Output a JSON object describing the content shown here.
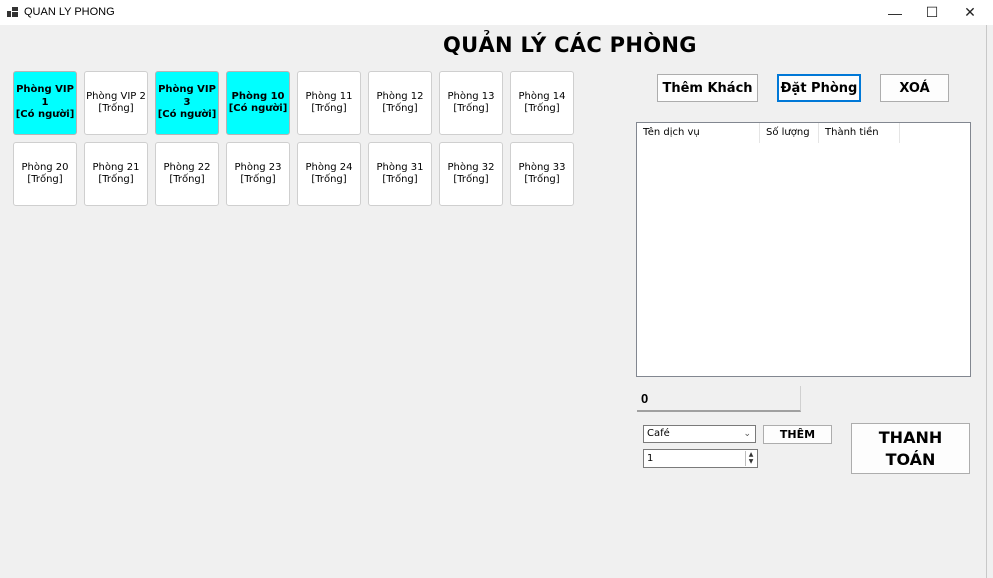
{
  "window": {
    "title": "QUAN LY PHONG",
    "minimize_glyph": "—",
    "maximize_glyph": "☐",
    "close_glyph": "✕"
  },
  "page_title": "QUẢN LÝ CÁC PHÒNG",
  "rooms": [
    {
      "name": "Phòng VIP\n1",
      "status": "[Có người]",
      "occupied": true
    },
    {
      "name": "Phòng VIP 2",
      "status": "[Trống]",
      "occupied": false
    },
    {
      "name": "Phòng VIP\n3",
      "status": "[Có người]",
      "occupied": true
    },
    {
      "name": "Phòng 10",
      "status": "[Có người]",
      "occupied": true
    },
    {
      "name": "Phòng 11",
      "status": "[Trống]",
      "occupied": false
    },
    {
      "name": "Phòng 12",
      "status": "[Trống]",
      "occupied": false
    },
    {
      "name": "Phòng 13",
      "status": "[Trống]",
      "occupied": false
    },
    {
      "name": "Phòng 14",
      "status": "[Trống]",
      "occupied": false
    },
    {
      "name": "Phòng 20",
      "status": "[Trống]",
      "occupied": false
    },
    {
      "name": "Phòng 21",
      "status": "[Trống]",
      "occupied": false
    },
    {
      "name": "Phòng 22",
      "status": "[Trống]",
      "occupied": false
    },
    {
      "name": "Phòng 23",
      "status": "[Trống]",
      "occupied": false
    },
    {
      "name": "Phòng 24",
      "status": "[Trống]",
      "occupied": false
    },
    {
      "name": "Phòng 31",
      "status": "[Trống]",
      "occupied": false
    },
    {
      "name": "Phòng 32",
      "status": "[Trống]",
      "occupied": false
    },
    {
      "name": "Phòng 33",
      "status": "[Trống]",
      "occupied": false
    }
  ],
  "toolbar": {
    "add_guest_label": "Thêm Khách",
    "book_room_label": "Đặt Phòng",
    "delete_label": "XOÁ"
  },
  "services_table": {
    "columns": [
      "Tên dịch vụ",
      "Số lượng",
      "Thành tiền"
    ],
    "rows": []
  },
  "total": "0",
  "service_select": {
    "selected": "Café"
  },
  "quantity": "1",
  "add_service_label": "THÊM",
  "pay_label_line1": "THANH",
  "pay_label_line2": "TOÁN",
  "colors": {
    "occupied": "#00ffff",
    "empty": "#ffffff",
    "focus": "#0078d7"
  }
}
